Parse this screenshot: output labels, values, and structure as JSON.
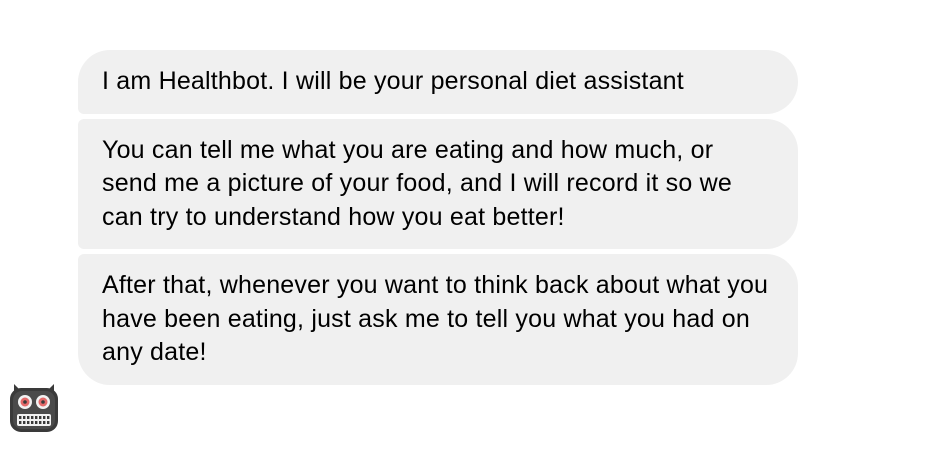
{
  "chat": {
    "bot_avatar_icon": "robot-face-icon",
    "messages": [
      {
        "sender": "Healthbot",
        "text": "I am Healthbot. I will be your personal diet assistant"
      },
      {
        "sender": "Healthbot",
        "text": "You can tell me what you are eating and how much, or send me a picture of your food, and I will record it so we can try to understand how you eat better!"
      },
      {
        "sender": "Healthbot",
        "text": "After that, whenever you want to think back about what you have been eating, just ask me to tell you what you had on any date!"
      }
    ]
  },
  "colors": {
    "bubble_background": "#f0f0f0",
    "text": "#000000",
    "avatar_body": "#3a3a3a",
    "avatar_eyes": "#e46a6a"
  }
}
